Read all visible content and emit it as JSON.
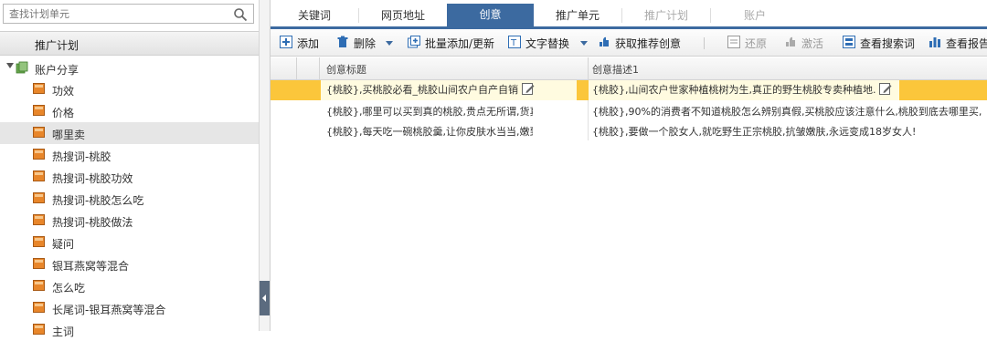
{
  "search": {
    "placeholder": "查找计划单元"
  },
  "panel": {
    "title": "推广计划"
  },
  "tree": {
    "root_label": "账户分享",
    "items": [
      {
        "label": "功效",
        "selected": false
      },
      {
        "label": "价格",
        "selected": false
      },
      {
        "label": "哪里卖",
        "selected": true
      },
      {
        "label": "热搜词-桃胶",
        "selected": false
      },
      {
        "label": "热搜词-桃胶功效",
        "selected": false
      },
      {
        "label": "热搜词-桃胶怎么吃",
        "selected": false
      },
      {
        "label": "热搜词-桃胶做法",
        "selected": false
      },
      {
        "label": "疑问",
        "selected": false
      },
      {
        "label": "银耳燕窝等混合",
        "selected": false
      },
      {
        "label": "怎么吃",
        "selected": false
      },
      {
        "label": "长尾词-银耳燕窝等混合",
        "selected": false
      },
      {
        "label": "主词",
        "selected": false
      }
    ]
  },
  "tabs": [
    {
      "label": "关键词",
      "state": "normal"
    },
    {
      "label": "网页地址",
      "state": "normal"
    },
    {
      "label": "创意",
      "state": "active"
    },
    {
      "label": "推广单元",
      "state": "normal"
    },
    {
      "label": "推广计划",
      "state": "disabled"
    },
    {
      "label": "账户",
      "state": "disabled"
    }
  ],
  "toolbar": {
    "add": "添加",
    "delete": "删除",
    "batch_add": "批量添加/更新",
    "text_replace": "文字替换",
    "get_recommend": "获取推荐创意",
    "restore": "还原",
    "activate": "激活",
    "view_search_terms": "查看搜索词",
    "view_report": "查看报告"
  },
  "grid": {
    "columns": {
      "title": "创意标题",
      "desc": "创意描述1"
    },
    "rows": [
      {
        "title": "{桃胶},买桃胶必看_桃胶山间农户自产自销",
        "desc": "{桃胶},山间农户世家种植桃树为生,真正的野生桃胶专卖种植地.",
        "highlighted": true
      },
      {
        "title": "{桃胶},哪里可以买到真的桃胶,贵点无所谓,货真就行",
        "desc": "{桃胶},90%的消费者不知道桃胶怎么辨别真假,买桃胶应该注意什么,桃胶到底去哪里买,",
        "highlighted": false
      },
      {
        "title": "{桃胶},每天吃一碗桃胶羹,让你皮肤水当当,嫩到掐出水",
        "desc": "{桃胶},要做一个胶女人,就吃野生正宗桃胶,抗皱嫩肤,永远变成18岁女人!",
        "highlighted": false
      }
    ]
  },
  "colors": {
    "accent": "#3c6aa0",
    "row_highlight": "#fbc63b",
    "folder": "#e8862a"
  }
}
